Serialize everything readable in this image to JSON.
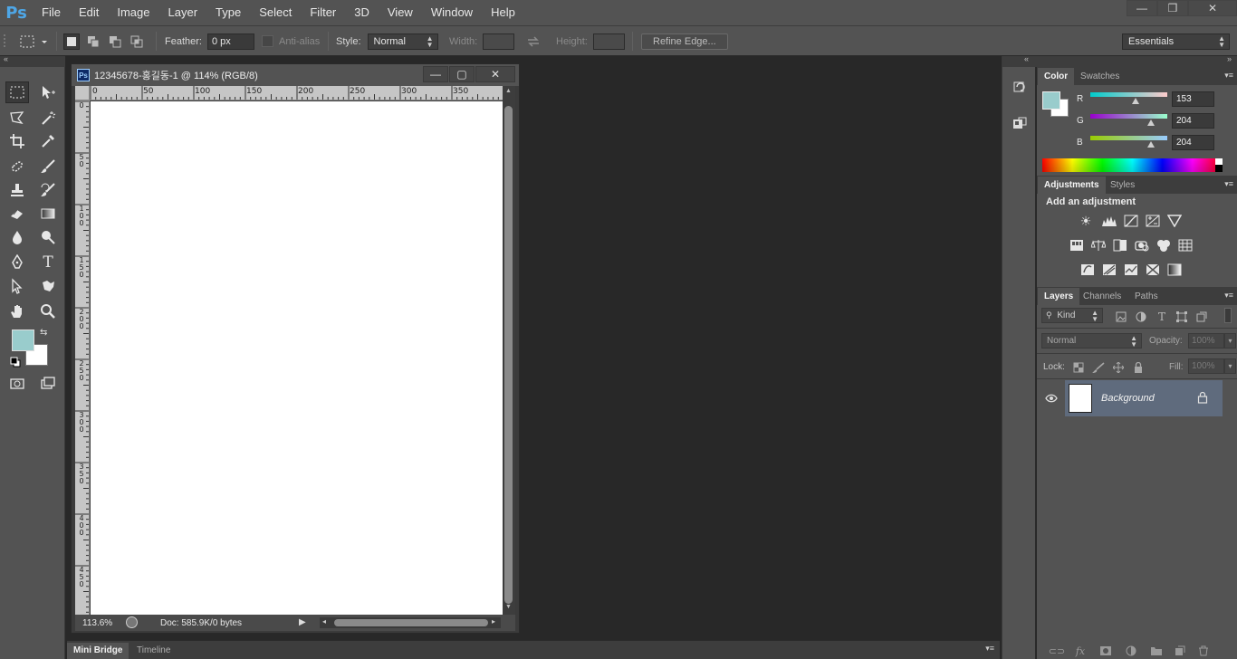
{
  "app": {
    "logo": "Ps"
  },
  "menu": [
    "File",
    "Edit",
    "Image",
    "Layer",
    "Type",
    "Select",
    "Filter",
    "3D",
    "View",
    "Window",
    "Help"
  ],
  "window_controls": {
    "minimize": "—",
    "restore": "❒",
    "close": "✕"
  },
  "options_bar": {
    "feather_label": "Feather:",
    "feather_value": "0 px",
    "antialias_label": "Anti-alias",
    "style_label": "Style:",
    "style_value": "Normal",
    "width_label": "Width:",
    "height_label": "Height:",
    "refine_edge": "Refine Edge...",
    "workspace": "Essentials"
  },
  "document": {
    "title": "12345678-홍길동-1 @ 114% (RGB/8)",
    "ps_icon": "Ps",
    "ruler_top_labels": [
      "0",
      "50",
      "100",
      "150",
      "200",
      "250",
      "300",
      "350"
    ],
    "ruler_left_labels": [
      "0",
      "5\n0",
      "1\n0\n0",
      "1\n5\n0",
      "2\n0\n0",
      "2\n5\n0",
      "3\n0\n0",
      "3\n5\n0",
      "4\n0\n0",
      "4\n5\n0"
    ],
    "zoom": "113.6%",
    "doc_info": "Doc: 585.9K/0 bytes"
  },
  "bottom_tabs": {
    "active": "Mini Bridge",
    "inactive": "Timeline"
  },
  "colors": {
    "foreground": "#99cccc",
    "background": "#ffffff",
    "accent_layer": "#5f6b7d"
  },
  "color_panel": {
    "tab_active": "Color",
    "tab_inactive": "Swatches",
    "r_label": "R",
    "r_value": "153",
    "g_label": "G",
    "g_value": "204",
    "b_label": "B",
    "b_value": "204"
  },
  "adjustments_panel": {
    "tab_active": "Adjustments",
    "tab_inactive": "Styles",
    "heading": "Add an adjustment"
  },
  "layers_panel": {
    "tab_active": "Layers",
    "tab_channels": "Channels",
    "tab_paths": "Paths",
    "kind_filter": "Kind",
    "blend_mode": "Normal",
    "opacity_label": "Opacity:",
    "opacity_value": "100%",
    "lock_label": "Lock:",
    "fill_label": "Fill:",
    "fill_value": "100%",
    "layers": [
      {
        "name": "Background",
        "locked": true,
        "visible": true
      }
    ]
  }
}
